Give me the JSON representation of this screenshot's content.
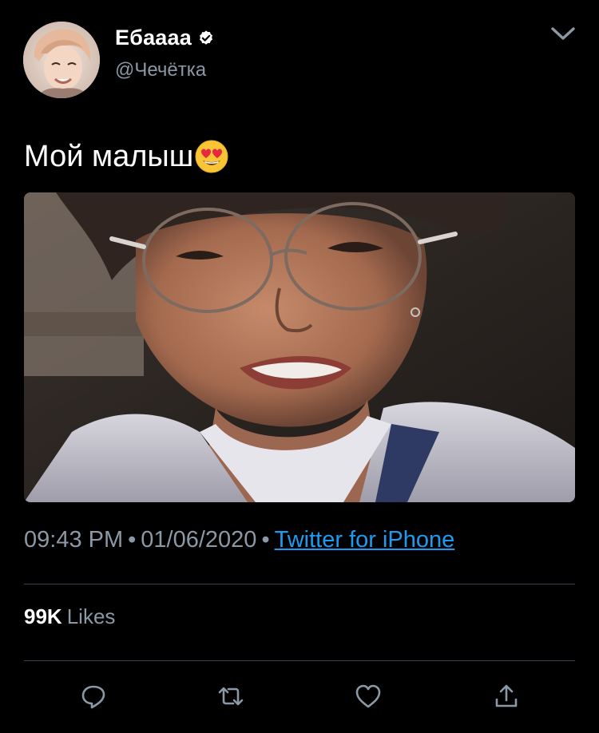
{
  "user": {
    "display_name": "Ебаааа",
    "handle": "@Чечётка",
    "verified": true,
    "avatar_icon": "profile-avatar"
  },
  "tweet": {
    "text": "Мой малыш",
    "emoji": "smiling-face-with-heart-eyes-emoji",
    "photo": "attached-photo"
  },
  "meta": {
    "time": "09:43 PM",
    "separator": "•",
    "date": "01/06/2020",
    "source": "Twitter for iPhone"
  },
  "stats": {
    "likes_count": "99K",
    "likes_label": "Likes"
  },
  "actions": [
    "reply-icon",
    "retweet-icon",
    "like-icon",
    "share-icon"
  ],
  "colors": {
    "background": "#000000",
    "primary_text": "#ffffff",
    "secondary_text": "#8b98a5",
    "link": "#1d9bf0",
    "divider": "#38444d"
  }
}
